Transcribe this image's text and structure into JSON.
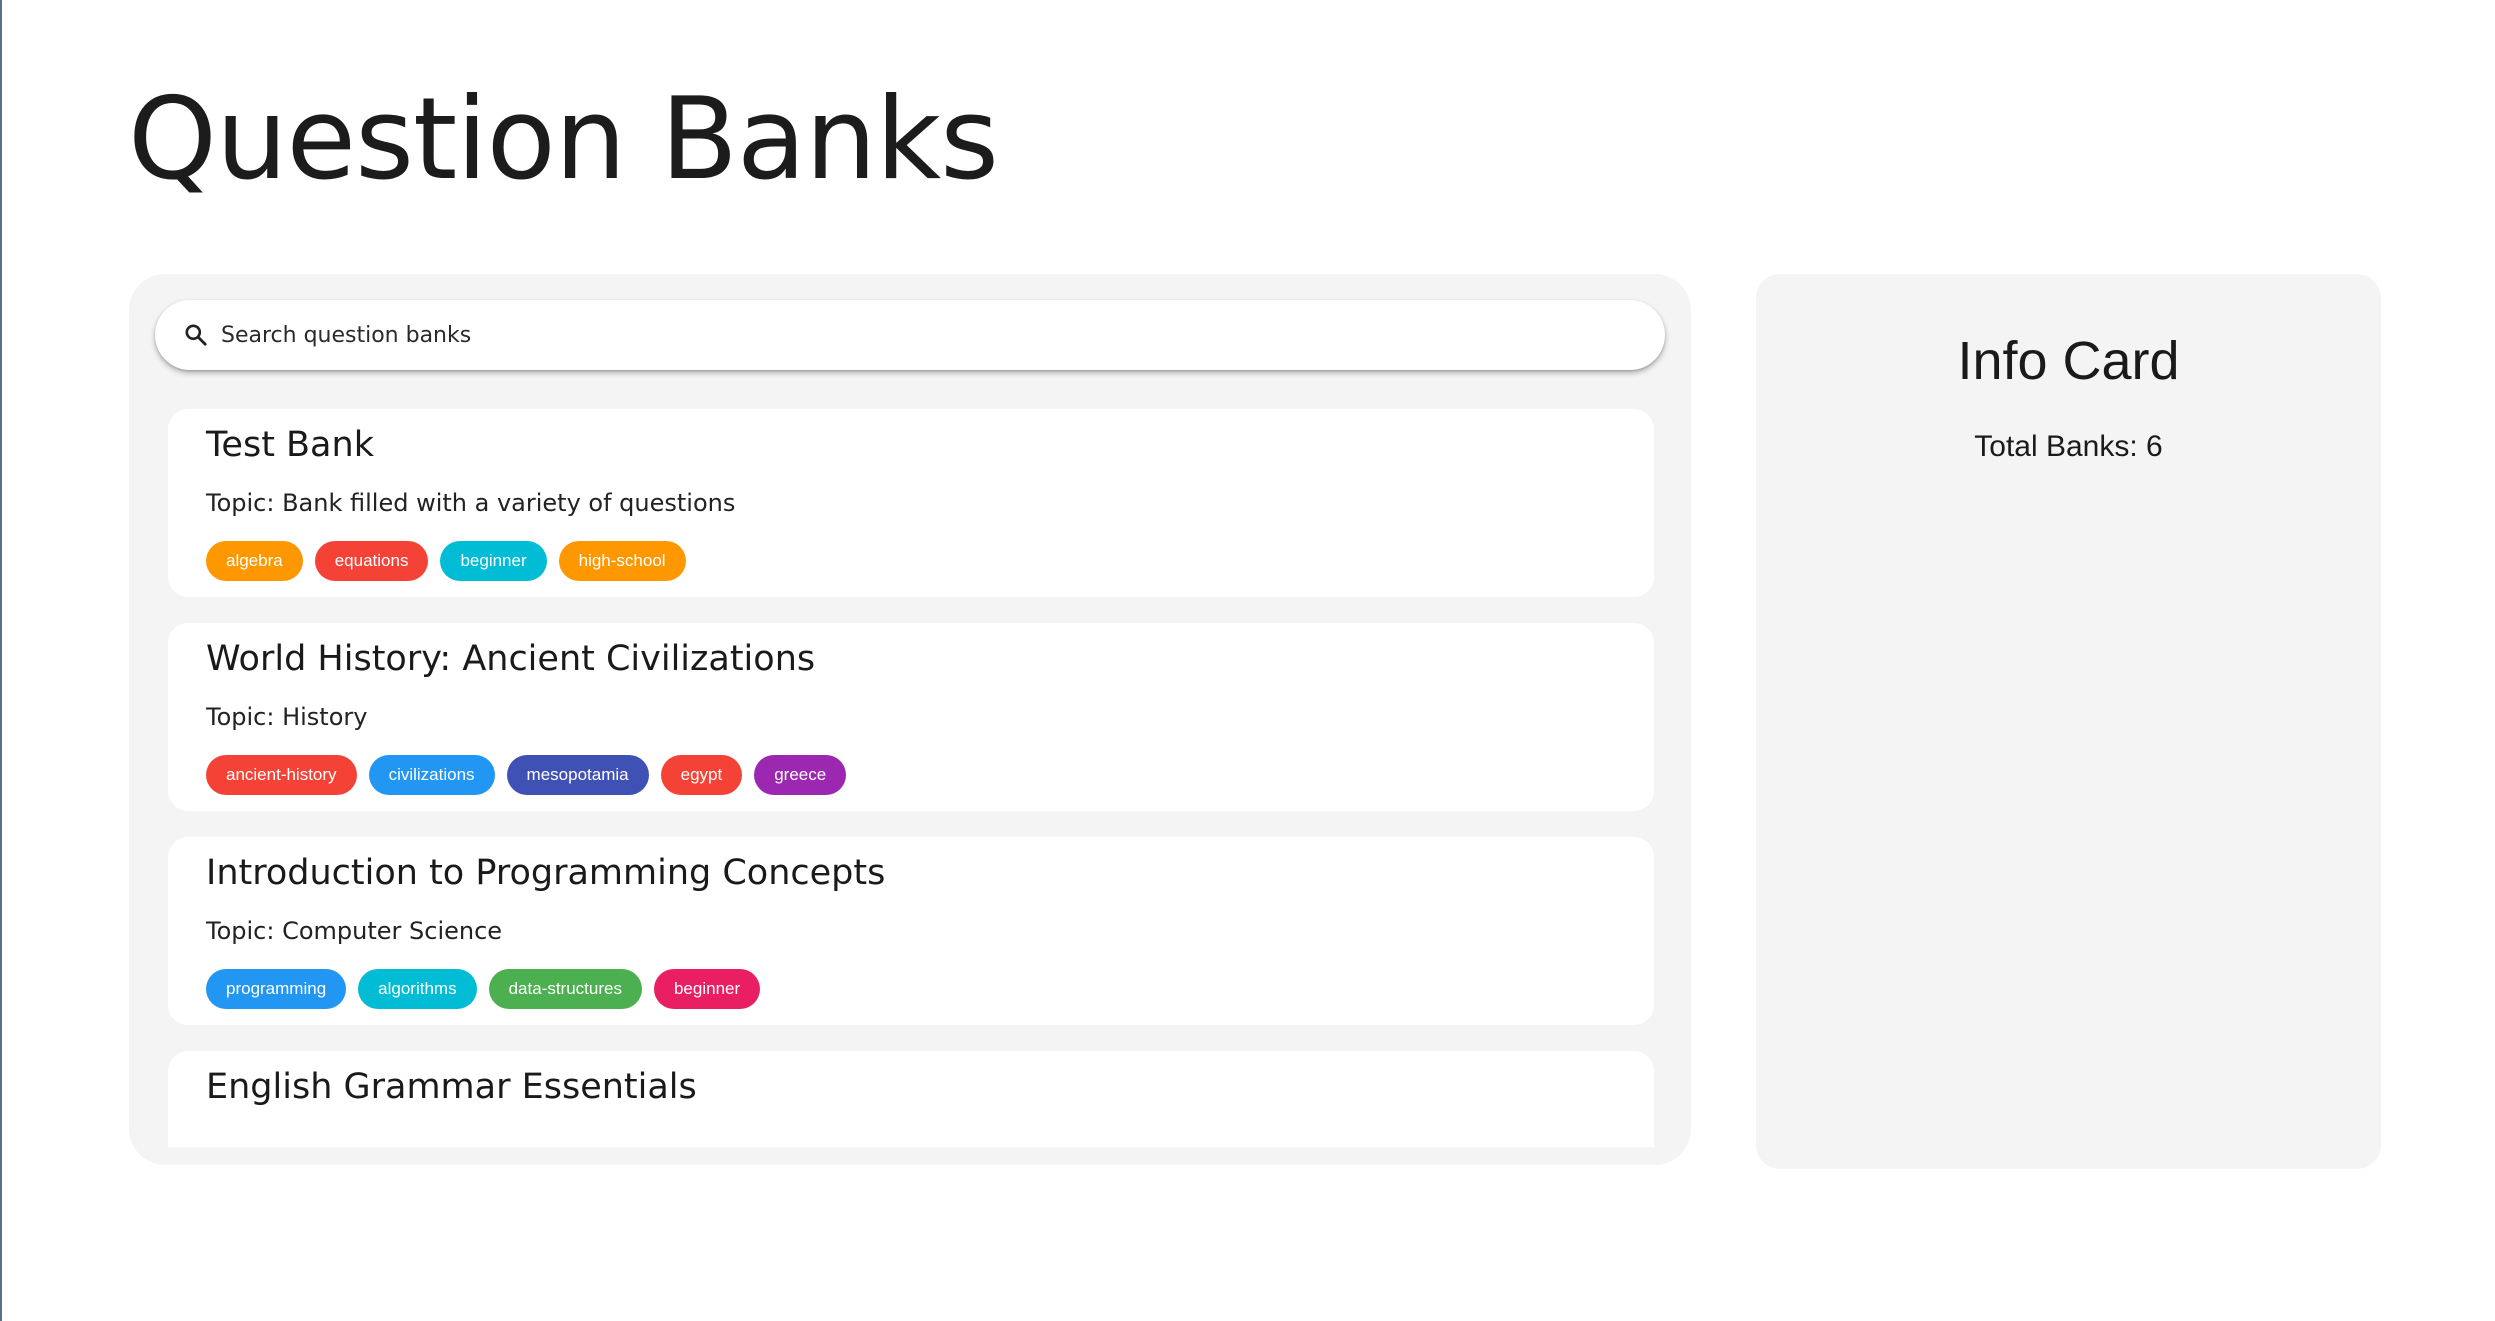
{
  "page": {
    "title": "Question Banks"
  },
  "search": {
    "placeholder": "Search question banks",
    "icon": "search-icon"
  },
  "banks": [
    {
      "title": "Test Bank",
      "topic": "Topic: Bank filled with a variety of questions",
      "tags": [
        {
          "label": "algebra",
          "color": "#FF9800"
        },
        {
          "label": "equations",
          "color": "#F44336"
        },
        {
          "label": "beginner",
          "color": "#00BCD4"
        },
        {
          "label": "high-school",
          "color": "#FF9800"
        }
      ]
    },
    {
      "title": "World History: Ancient Civilizations",
      "topic": "Topic: History",
      "tags": [
        {
          "label": "ancient-history",
          "color": "#F44336"
        },
        {
          "label": "civilizations",
          "color": "#2196F3"
        },
        {
          "label": "mesopotamia",
          "color": "#3F51B5"
        },
        {
          "label": "egypt",
          "color": "#F44336"
        },
        {
          "label": "greece",
          "color": "#9C27B0"
        }
      ]
    },
    {
      "title": "Introduction to Programming Concepts",
      "topic": "Topic: Computer Science",
      "tags": [
        {
          "label": "programming",
          "color": "#2196F3"
        },
        {
          "label": "algorithms",
          "color": "#00BCD4"
        },
        {
          "label": "data-structures",
          "color": "#4CAF50"
        },
        {
          "label": "beginner",
          "color": "#E91E63"
        }
      ]
    },
    {
      "title": "English Grammar Essentials",
      "topic": "",
      "tags": []
    }
  ],
  "info_card": {
    "title": "Info Card",
    "total_label": "Total Banks: 6"
  }
}
